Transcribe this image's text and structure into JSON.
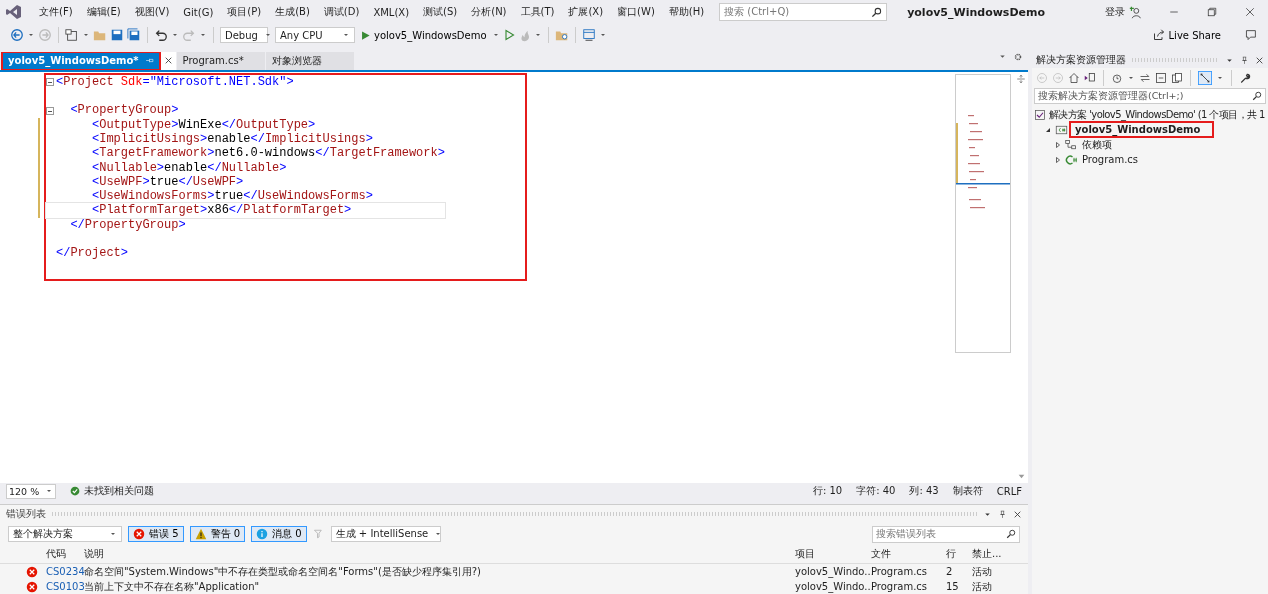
{
  "menu_bar": {
    "items": [
      "文件(F)",
      "编辑(E)",
      "视图(V)",
      "Git(G)",
      "项目(P)",
      "生成(B)",
      "调试(D)",
      "XML(X)",
      "测试(S)",
      "分析(N)",
      "工具(T)",
      "扩展(X)",
      "窗口(W)",
      "帮助(H)"
    ],
    "search": {
      "placeholder": "搜索 (Ctrl+Q)"
    },
    "title": "yolov5_WindowsDemo",
    "sign_in": "登录"
  },
  "toolbar": {
    "configuration": "Debug",
    "platform": "Any CPU",
    "run_target": "yolov5_WindowsDemo",
    "live_share": "Live Share"
  },
  "tabs": [
    {
      "label": "yolov5_WindowsDemo*",
      "selected": true,
      "highlighted": true
    },
    {
      "label": "Program.cs*",
      "selected": false,
      "highlighted": false
    },
    {
      "label": "对象浏览器",
      "selected": false,
      "highlighted": false
    }
  ],
  "editor": {
    "highlighted": true,
    "lines": [
      {
        "kind": "code",
        "foldable": true,
        "changed": false,
        "current": false,
        "tokens": [
          {
            "kind": "punct",
            "text": "<"
          },
          {
            "kind": "name",
            "text": "Project"
          },
          {
            "kind": "attr",
            "text": " Sdk"
          },
          {
            "kind": "punct",
            "text": "=\""
          },
          {
            "kind": "value",
            "text": "Microsoft.NET.Sdk"
          },
          {
            "kind": "punct",
            "text": "\">"
          }
        ]
      },
      {
        "kind": "blank",
        "foldable": false,
        "changed": false,
        "current": false
      },
      {
        "kind": "code",
        "foldable": true,
        "changed": false,
        "current": false,
        "tokens": [
          {
            "kind": "punct",
            "text": "  <"
          },
          {
            "kind": "name",
            "text": "PropertyGroup"
          },
          {
            "kind": "punct",
            "text": ">"
          }
        ]
      },
      {
        "kind": "code",
        "foldable": false,
        "changed": true,
        "current": false,
        "tokens": [
          {
            "kind": "punct",
            "text": "     <"
          },
          {
            "kind": "name",
            "text": "OutputType"
          },
          {
            "kind": "punct",
            "text": ">"
          },
          {
            "kind": "text",
            "text": "WinExe"
          },
          {
            "kind": "punct",
            "text": "</"
          },
          {
            "kind": "name",
            "text": "OutputType"
          },
          {
            "kind": "punct",
            "text": ">"
          }
        ]
      },
      {
        "kind": "code",
        "foldable": false,
        "changed": true,
        "current": false,
        "tokens": [
          {
            "kind": "punct",
            "text": "     <"
          },
          {
            "kind": "name",
            "text": "ImplicitUsings"
          },
          {
            "kind": "punct",
            "text": ">"
          },
          {
            "kind": "text",
            "text": "enable"
          },
          {
            "kind": "punct",
            "text": "</"
          },
          {
            "kind": "name",
            "text": "ImplicitUsings"
          },
          {
            "kind": "punct",
            "text": ">"
          }
        ]
      },
      {
        "kind": "code",
        "foldable": false,
        "changed": true,
        "current": false,
        "tokens": [
          {
            "kind": "punct",
            "text": "     <"
          },
          {
            "kind": "name",
            "text": "TargetFramework"
          },
          {
            "kind": "punct",
            "text": ">"
          },
          {
            "kind": "text",
            "text": "net6.0-windows"
          },
          {
            "kind": "punct",
            "text": "</"
          },
          {
            "kind": "name",
            "text": "TargetFramework"
          },
          {
            "kind": "punct",
            "text": ">"
          }
        ]
      },
      {
        "kind": "code",
        "foldable": false,
        "changed": true,
        "current": false,
        "tokens": [
          {
            "kind": "punct",
            "text": "     <"
          },
          {
            "kind": "name",
            "text": "Nullable"
          },
          {
            "kind": "punct",
            "text": ">"
          },
          {
            "kind": "text",
            "text": "enable"
          },
          {
            "kind": "punct",
            "text": "</"
          },
          {
            "kind": "name",
            "text": "Nullable"
          },
          {
            "kind": "punct",
            "text": ">"
          }
        ]
      },
      {
        "kind": "code",
        "foldable": false,
        "changed": true,
        "current": false,
        "tokens": [
          {
            "kind": "punct",
            "text": "     <"
          },
          {
            "kind": "name",
            "text": "UseWPF"
          },
          {
            "kind": "punct",
            "text": ">"
          },
          {
            "kind": "text",
            "text": "true"
          },
          {
            "kind": "punct",
            "text": "</"
          },
          {
            "kind": "name",
            "text": "UseWPF"
          },
          {
            "kind": "punct",
            "text": ">"
          }
        ]
      },
      {
        "kind": "code",
        "foldable": false,
        "changed": true,
        "current": false,
        "tokens": [
          {
            "kind": "punct",
            "text": "     <"
          },
          {
            "kind": "name",
            "text": "UseWindowsForms"
          },
          {
            "kind": "punct",
            "text": ">"
          },
          {
            "kind": "text",
            "text": "true"
          },
          {
            "kind": "punct",
            "text": "</"
          },
          {
            "kind": "name",
            "text": "UseWindowsForms"
          },
          {
            "kind": "punct",
            "text": ">"
          }
        ]
      },
      {
        "kind": "code",
        "foldable": false,
        "changed": true,
        "current": true,
        "tokens": [
          {
            "kind": "punct",
            "text": "     <"
          },
          {
            "kind": "name",
            "text": "PlatformTarget"
          },
          {
            "kind": "punct",
            "text": ">"
          },
          {
            "kind": "text",
            "text": "x86"
          },
          {
            "kind": "punct",
            "text": "</"
          },
          {
            "kind": "name",
            "text": "PlatformTarget"
          },
          {
            "kind": "punct",
            "text": ">"
          }
        ]
      },
      {
        "kind": "code",
        "foldable": false,
        "changed": false,
        "current": false,
        "tokens": [
          {
            "kind": "punct",
            "text": "  </"
          },
          {
            "kind": "name",
            "text": "PropertyGroup"
          },
          {
            "kind": "punct",
            "text": ">"
          }
        ]
      },
      {
        "kind": "blank",
        "foldable": false,
        "changed": false,
        "current": false
      },
      {
        "kind": "code",
        "foldable": false,
        "changed": false,
        "current": false,
        "tokens": [
          {
            "kind": "punct",
            "text": "</"
          },
          {
            "kind": "name",
            "text": "Project"
          },
          {
            "kind": "punct",
            "text": ">"
          }
        ]
      }
    ]
  },
  "status_bar": {
    "zoom": "120 %",
    "issues": "未找到相关问题",
    "line": "行: 10",
    "character": "字符: 40",
    "column": "列: 43",
    "indent": "制表符",
    "line_ending": "CRLF"
  },
  "error_list": {
    "title": "错误列表",
    "scope": "整个解决方案",
    "filters": [
      {
        "kind": "error",
        "label": "错误 5",
        "selected": true
      },
      {
        "kind": "warning",
        "label": "警告 0",
        "selected": true
      },
      {
        "kind": "info",
        "label": "消息 0",
        "selected": true
      }
    ],
    "source": "生成 + IntelliSense",
    "search": {
      "placeholder": "搜索错误列表"
    },
    "columns": [
      "代码",
      "说明",
      "项目",
      "文件",
      "行",
      "禁止..."
    ],
    "rows": [
      {
        "kind": "error",
        "code": "CS0234",
        "description": "命名空间\"System.Windows\"中不存在类型或命名空间名\"Forms\"(是否缺少程序集引用?)",
        "project": "yolov5_Windo...",
        "file": "Program.cs",
        "line": "2",
        "suppression": "活动"
      },
      {
        "kind": "error",
        "code": "CS0103",
        "description": "当前上下文中不存在名称\"Application\"",
        "project": "yolov5_Windo...",
        "file": "Program.cs",
        "line": "15",
        "suppression": "活动"
      }
    ]
  },
  "solution_explorer": {
    "title": "解决方案资源管理器",
    "search": {
      "placeholder": "搜索解决方案资源管理器(Ctrl+;)"
    },
    "tree": [
      {
        "kind": "solution",
        "label": "解决方案 'yolov5_WindowsDemo' (1 个项目，共 1",
        "highlighted": false,
        "children": [
          {
            "kind": "project",
            "label": "yolov5_WindowsDemo",
            "expanded": true,
            "highlighted": true,
            "children": [
              {
                "kind": "dependencies",
                "label": "依赖项",
                "expanded": false,
                "highlighted": false
              },
              {
                "kind": "csharp",
                "label": "Program.cs",
                "expanded": false,
                "highlighted": false
              }
            ]
          }
        ]
      }
    ]
  }
}
